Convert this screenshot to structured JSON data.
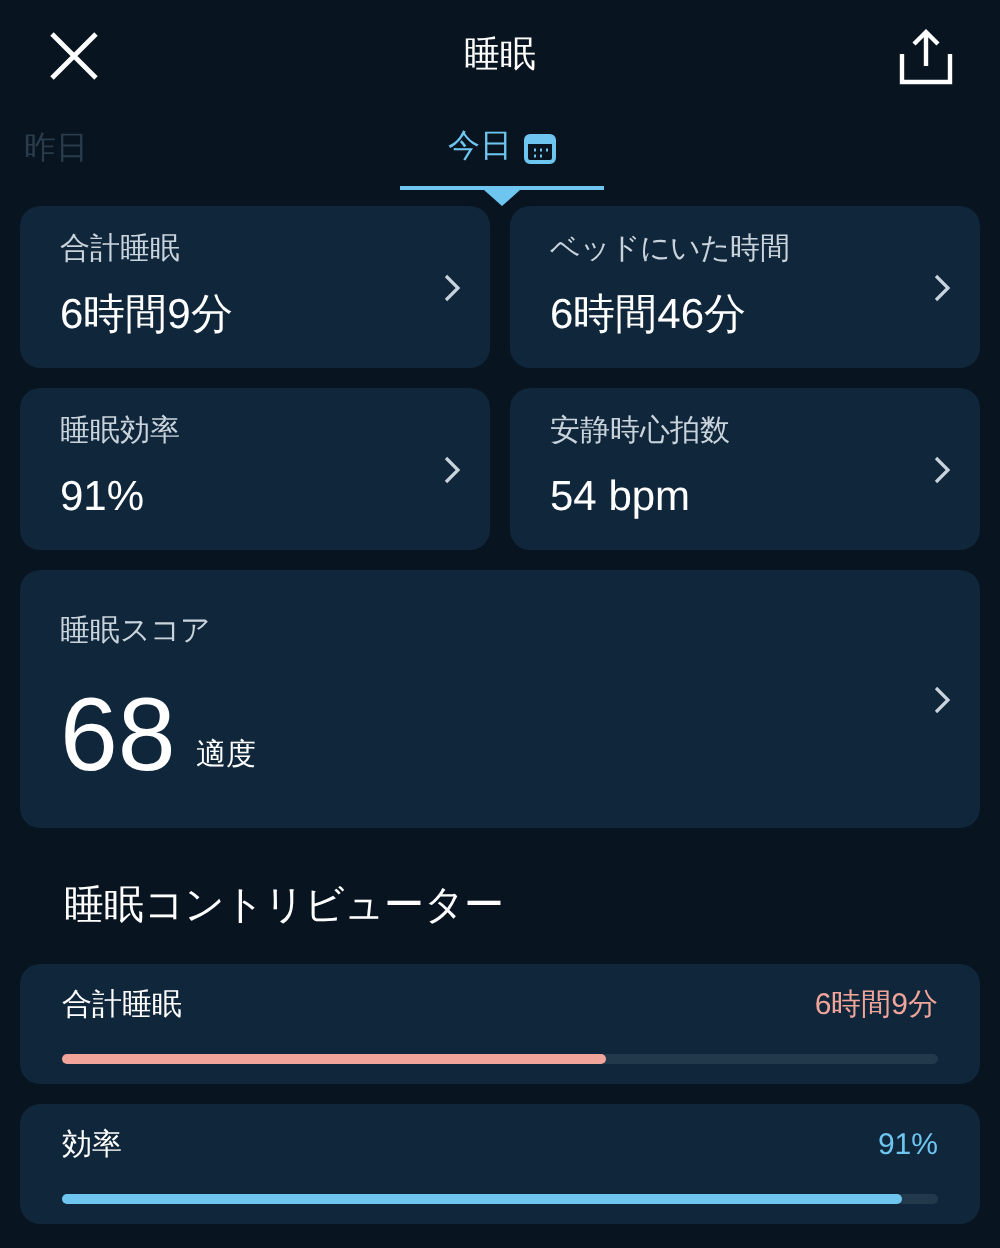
{
  "header": {
    "title": "睡眠"
  },
  "tabs": [
    {
      "label": "昨日",
      "selected": false
    },
    {
      "label": "今日",
      "selected": true
    }
  ],
  "metrics": [
    {
      "label": "合計睡眠",
      "value": "6時間9分"
    },
    {
      "label": "ベッドにいた時間",
      "value": "6時間46分"
    },
    {
      "label": "睡眠効率",
      "value": "91%"
    },
    {
      "label": "安静時心拍数",
      "value": "54 bpm"
    }
  ],
  "score": {
    "label": "睡眠スコア",
    "value": "68",
    "rating": "適度"
  },
  "contributors": {
    "title": "睡眠コントリビューター",
    "items": [
      {
        "label": "合計睡眠",
        "value": "6時間9分",
        "level": 0.62,
        "color": "#f0a49a"
      },
      {
        "label": "効率",
        "value": "91%",
        "level": 0.96,
        "color": "#6ec6f0"
      }
    ]
  }
}
